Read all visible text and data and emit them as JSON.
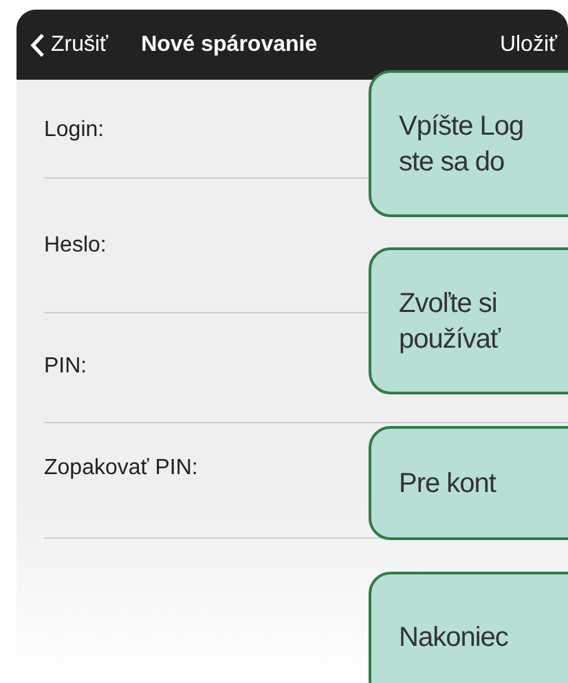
{
  "nav": {
    "cancel": "Zrušiť",
    "title": "Nové spárovanie",
    "save": "Uložiť"
  },
  "fields": [
    {
      "label": "Login:"
    },
    {
      "label": "Heslo:"
    },
    {
      "label": "PIN:"
    },
    {
      "label": "Zopakovať PIN:"
    }
  ],
  "callouts": [
    {
      "lines": [
        "Vpíšte Log",
        "ste sa do"
      ]
    },
    {
      "lines": [
        "Zvoľte si",
        "používať"
      ]
    },
    {
      "lines": [
        "Pre kont"
      ]
    },
    {
      "lines": [
        "Nakoniec"
      ]
    }
  ]
}
